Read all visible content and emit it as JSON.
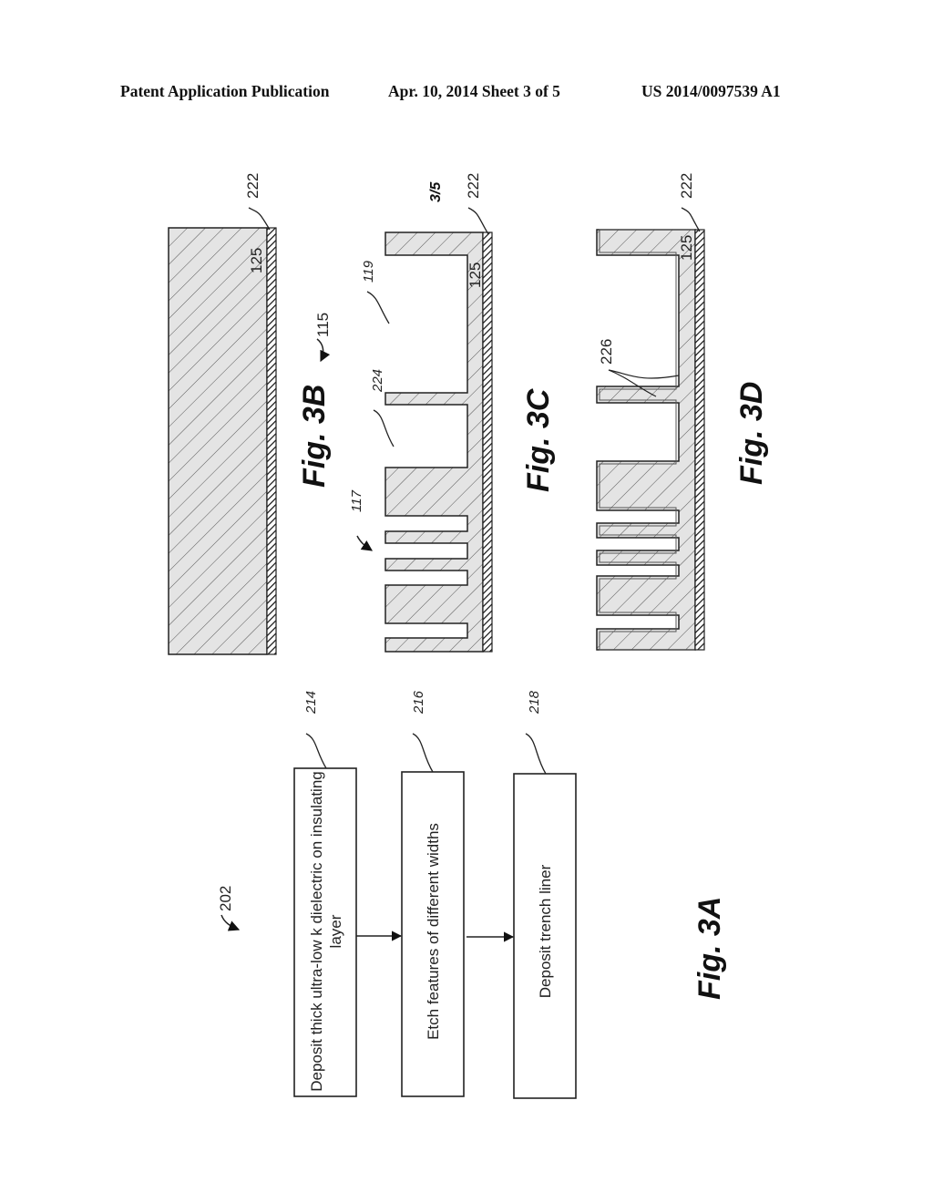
{
  "header": {
    "publication": "Patent Application Publication",
    "date_sheet": "Apr. 10, 2014  Sheet 3 of 5",
    "patent_number": "US 2014/0097539 A1"
  },
  "sheet_mark": "3/5",
  "figures": {
    "fig3b": {
      "label": "Fig. 3B",
      "refs": {
        "layer": "125",
        "insulator": "222",
        "stack": "115"
      }
    },
    "fig3c": {
      "label": "Fig. 3C",
      "refs": {
        "layer": "125",
        "insulator": "222",
        "wide_trench": "119",
        "narrow_group": "117",
        "fin": "224"
      }
    },
    "fig3d": {
      "label": "Fig. 3D",
      "refs": {
        "layer": "125",
        "insulator": "222",
        "liner": "226"
      }
    },
    "fig3a": {
      "label": "Fig. 3A",
      "ref": "202",
      "steps": [
        {
          "ref": "214",
          "text": "Deposit thick ultra-low k dielectric on insulating layer"
        },
        {
          "ref": "216",
          "text": "Etch features of different widths"
        },
        {
          "ref": "218",
          "text": "Deposit trench liner"
        }
      ]
    }
  },
  "colors": {
    "ink": "#222222",
    "fill": "#e6e6e6",
    "paper": "#ffffff"
  }
}
